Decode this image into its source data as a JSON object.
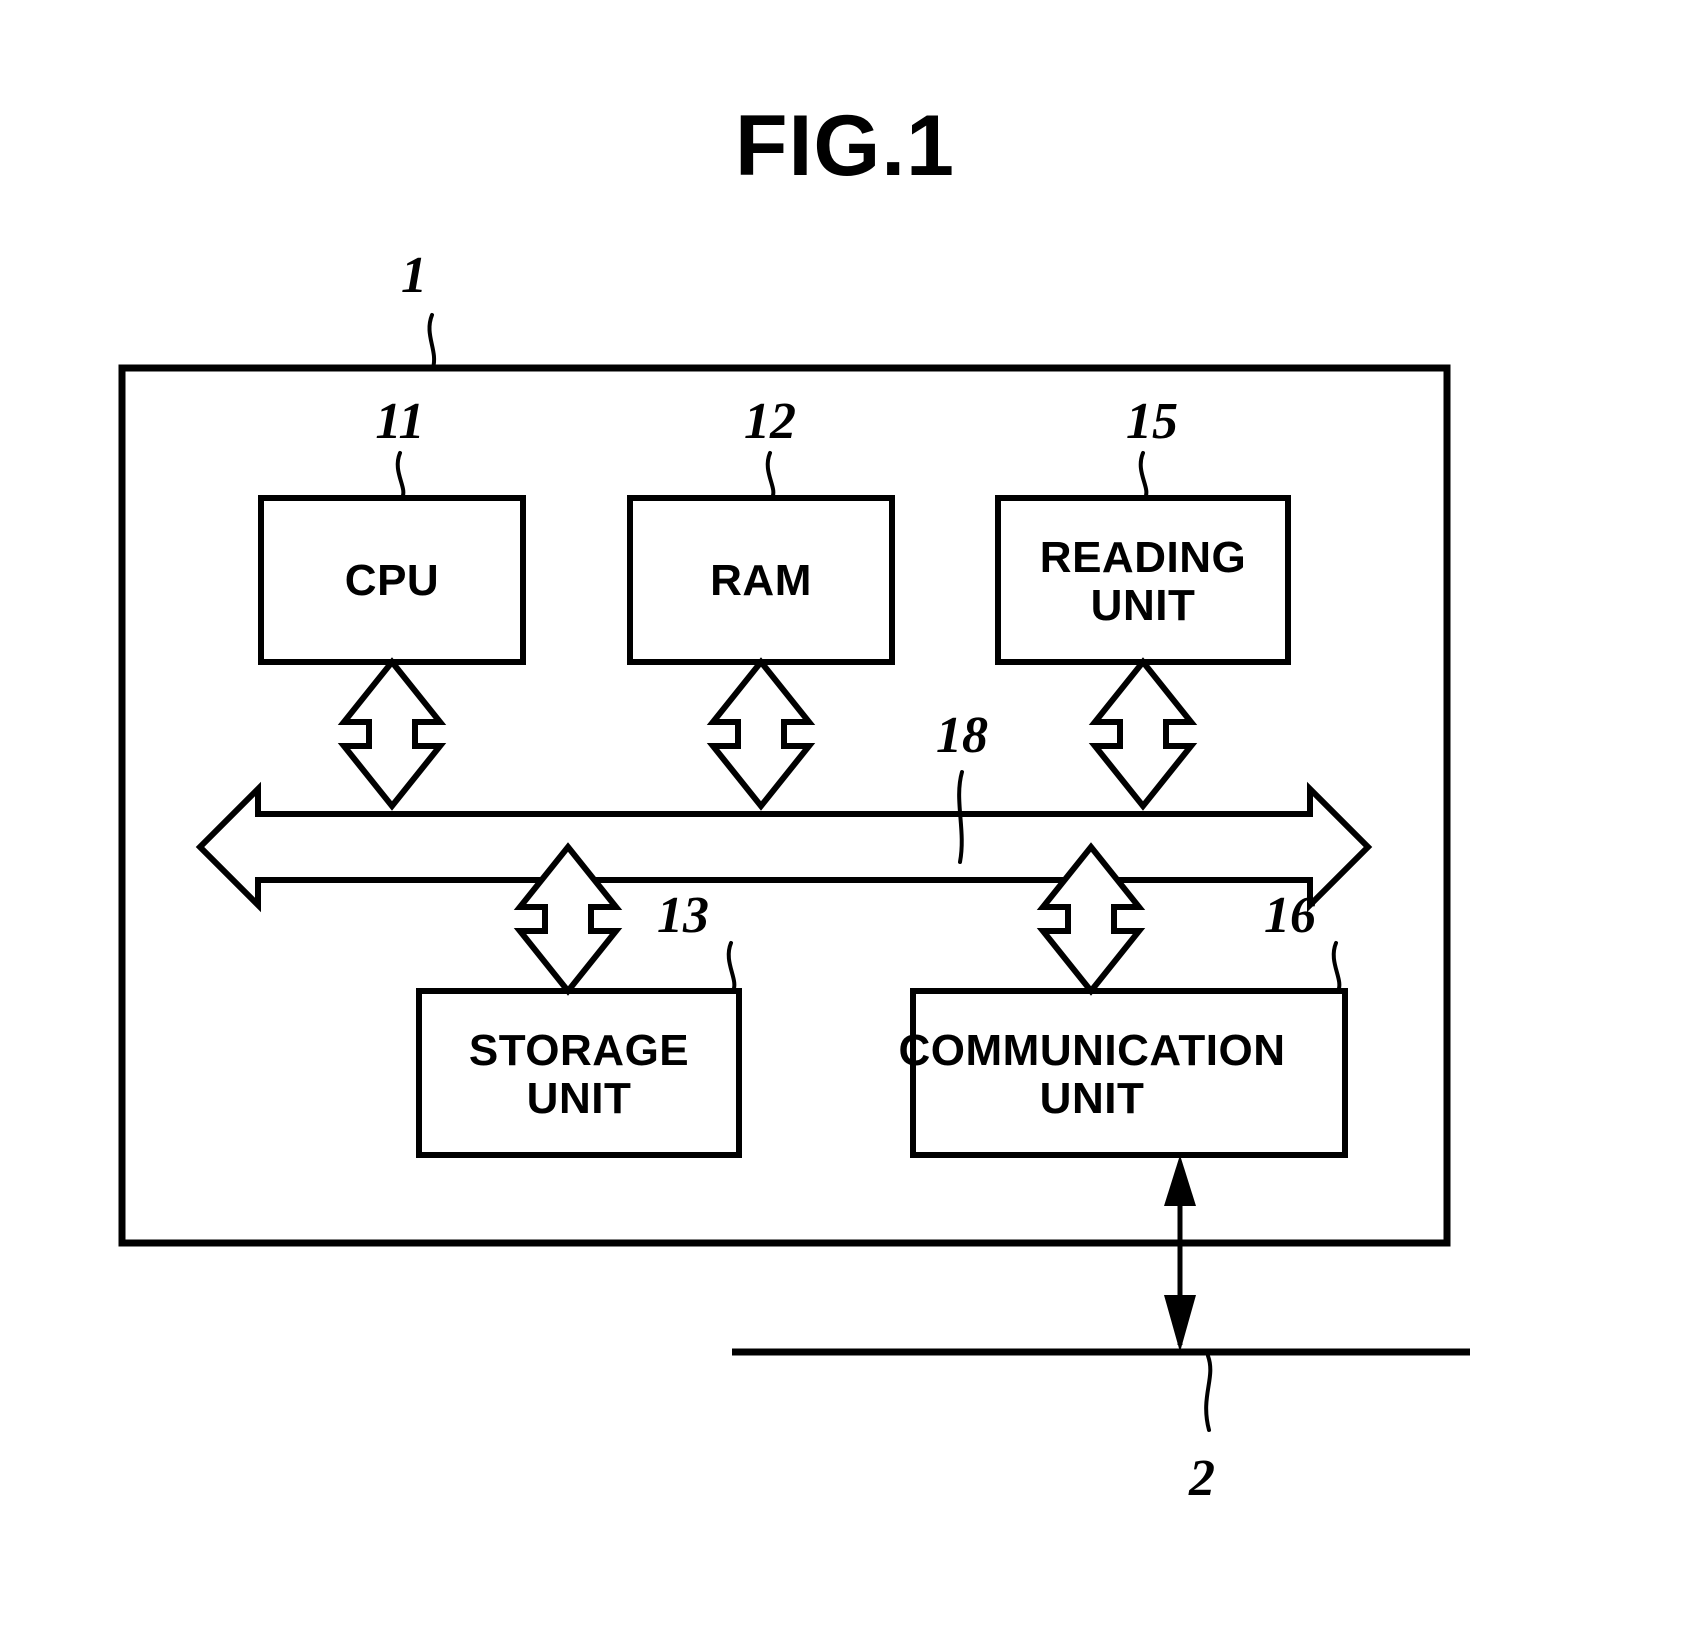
{
  "figure": {
    "title": "FIG.1",
    "system_ref": "1",
    "network_ref": "2",
    "bus_ref": "18"
  },
  "blocks": [
    {
      "id": "cpu",
      "label": "CPU",
      "label_line2": "",
      "ref": "11"
    },
    {
      "id": "ram",
      "label": "RAM",
      "label_line2": "",
      "ref": "12"
    },
    {
      "id": "reading_unit",
      "label": "READING",
      "label_line2": "UNIT",
      "ref": "15"
    },
    {
      "id": "storage_unit",
      "label": "STORAGE",
      "label_line2": "UNIT",
      "ref": "13"
    },
    {
      "id": "communication_unit",
      "label": "COMMUNICATION",
      "label_line2": "UNIT",
      "ref": "16"
    }
  ],
  "connections": {
    "bus_name": "bus",
    "network_name": "network"
  },
  "colors": {
    "stroke": "#000000",
    "fill": "#ffffff",
    "background": "#ffffff"
  }
}
